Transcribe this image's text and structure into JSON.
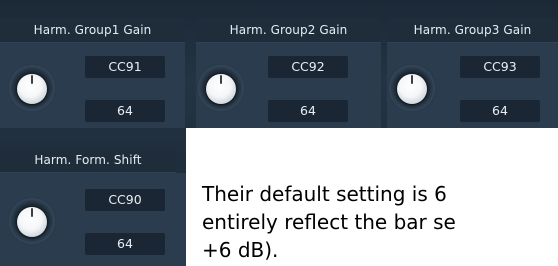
{
  "modules": [
    {
      "label": "Harm. Group1 Gain",
      "cc": "CC91",
      "value": "64"
    },
    {
      "label": "Harm. Group2 Gain",
      "cc": "CC92",
      "value": "64"
    },
    {
      "label": "Harm. Group3 Gain",
      "cc": "CC93",
      "value": "64"
    },
    {
      "label": "Harm. Form. Shift",
      "cc": "CC90",
      "value": "64"
    }
  ],
  "doc": {
    "line1": "Their default setting is 6",
    "line2": "entirely reflect the bar se",
    "line3": "+6 dB)."
  }
}
